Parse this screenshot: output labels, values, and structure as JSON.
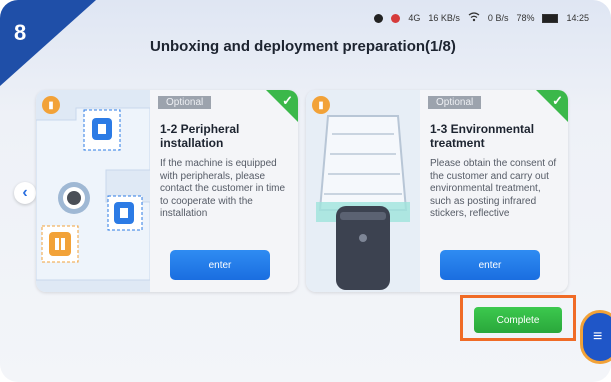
{
  "step_badge": "8",
  "status_bar": {
    "signal_text": "4G",
    "speed_up": "16",
    "speed_up_unit": "KB/s",
    "speed_down": "0",
    "speed_down_unit": "B/s",
    "battery": "78%",
    "time": "14:25"
  },
  "page_title": "Unboxing and deployment preparation(1/8)",
  "cards": [
    {
      "tag": "Optional",
      "title": "1-2 Peripheral installation",
      "description": "If the machine is equipped with peripherals, please contact the customer in time to cooperate with the installation",
      "button": "enter",
      "completed": true
    },
    {
      "tag": "Optional",
      "title": "1-3 Environmental treatment",
      "description": "Please obtain the consent of the customer and carry out environmental treatment, such as posting infrared stickers, reflective",
      "button": "enter",
      "completed": true
    }
  ],
  "complete_button": "Complete",
  "colors": {
    "corner": "#1f4fa8",
    "enter": "#1a6ee0",
    "complete": "#2aa73b",
    "highlight": "#f06b26",
    "check": "#3bb84a"
  },
  "icons": {
    "book": "book-icon",
    "check": "check-icon",
    "back": "chevron-left-icon",
    "menu": "menu-icon"
  }
}
